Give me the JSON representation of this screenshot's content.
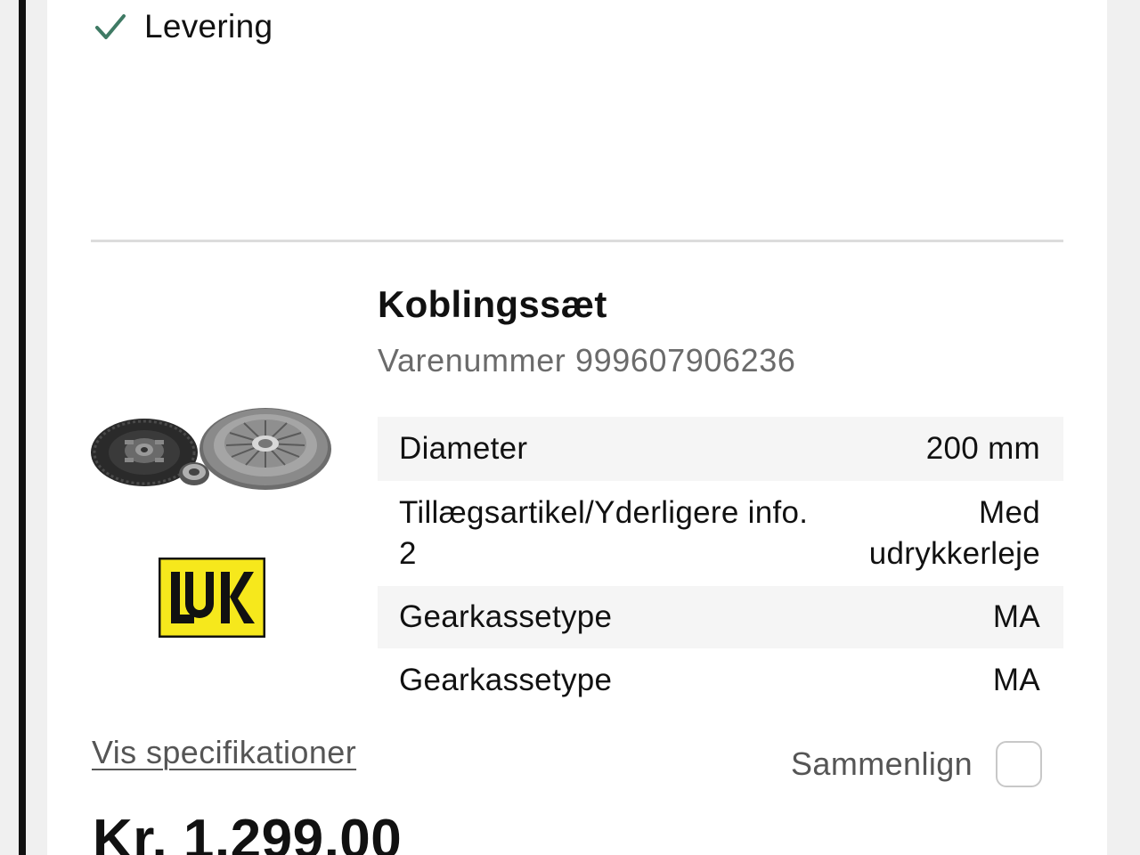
{
  "delivery": {
    "label": "Levering",
    "icon": "check-icon",
    "icon_color": "#3f7a64"
  },
  "product": {
    "image": "clutch-kit-image",
    "brand": "LUK",
    "brand_colors": {
      "background": "#f6e81c",
      "text": "#111111"
    },
    "title": "Koblingssæt",
    "sku": "Varenummer 999607906236",
    "specs": [
      {
        "key": "Diameter",
        "value": "200 mm"
      },
      {
        "key": "Tillægsartikel/Yderligere info. 2",
        "value": "Med udrykkerleje"
      },
      {
        "key": "Gearkassetype",
        "value": "MA"
      },
      {
        "key": "Gearkassetype",
        "value": "MA"
      }
    ],
    "spec_link": "Vis specifikationer",
    "compare_label": "Sammenlign",
    "compare_checked": false,
    "price": "Kr. 1.299,00"
  }
}
